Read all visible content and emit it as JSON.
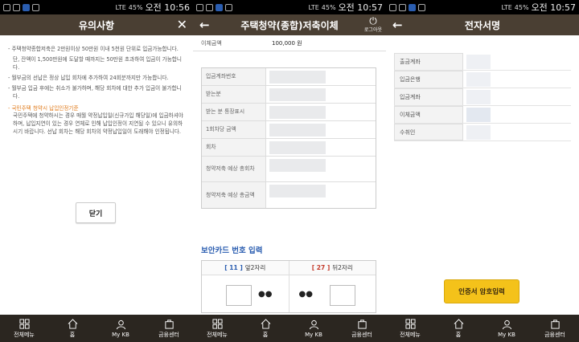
{
  "status": {
    "p1": {
      "battery": "45%",
      "time": "오전 10:56",
      "net": "LTE"
    },
    "p2": {
      "battery": "45%",
      "time": "오전 10:57",
      "net": "LTE"
    },
    "p3": {
      "battery": "45%",
      "time": "오전 10:57",
      "net": "LTE"
    }
  },
  "notice_panel": {
    "title": "유의사항",
    "items": [
      "- 주택청약종합저축은 2만원이상 50만원 이내 5천원 단위로 입금가능합니다.",
      "단, 잔액이 1,500만원에 도달할 때까지는 50만원 초과하여 입금이 가능합니다.",
      "- 월부금의 선납은 정상 납입 회차에 추가하여 24회분까지만 가능합니다.",
      "- 월부금 입금 후에는 취소가 불가하며, 해당 회차에 대한 추가 입금이 불가합니다."
    ],
    "highlight": "- 국민주택 청약시 납입인정기준",
    "sub": "국민주택에 청약하시는 경우 매월 약정납입일(신규가입 해당일)에 입금하셔야 하며, 납입지연이 있는 경우 연체로 인해 납입인정이 지연될 수 있으니 유의하시기 바랍니다. 선납 회차는 해당 회차의 약정납입일이 도래해야 인정됩니다.",
    "close_button": "닫기"
  },
  "transfer_panel": {
    "title": "주택청약(종합)저축이체",
    "logout": "로그아웃",
    "amount_label": "이체금액",
    "amount_value": "100,000 원",
    "rows": [
      "입금계좌번호",
      "받는분",
      "받는 분 통장표시",
      "1회차당 금액",
      "회차",
      "청약저축 예상 총회차",
      "청약저축 예상 총금액"
    ],
    "security_title": "보안카드 번호 입력",
    "sec_left": {
      "num": "[ 11 ]",
      "label": "앞2자리",
      "dots": "●●"
    },
    "sec_right": {
      "num": "[ 27 ]",
      "label": "뒤2자리",
      "dots": "●●"
    }
  },
  "sign_panel": {
    "title": "전자서명",
    "rows": [
      "출금계좌",
      "입금은행",
      "입금계좌",
      "이체금액",
      "수취인"
    ],
    "cert_button": "인증서 암호입력"
  },
  "bottom_nav": [
    "전체메뉴",
    "홈",
    "My KB",
    "금융센터"
  ]
}
